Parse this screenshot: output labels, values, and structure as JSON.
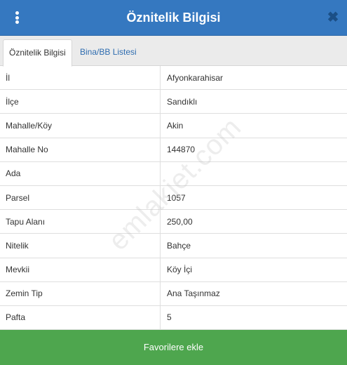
{
  "header": {
    "title": "Öznitelik Bilgisi",
    "close_glyph": "✖",
    "menu_icon": "vertical-dots-icon",
    "close_icon": "close-icon",
    "color": "#3578c0"
  },
  "tabs": [
    {
      "label": "Öznitelik Bilgisi",
      "active": true
    },
    {
      "label": "Bina/BB Listesi",
      "active": false
    }
  ],
  "rows": [
    {
      "label": "İl",
      "value": "Afyonkarahisar"
    },
    {
      "label": "İlçe",
      "value": "Sandıklı"
    },
    {
      "label": "Mahalle/Köy",
      "value": "Akin"
    },
    {
      "label": "Mahalle No",
      "value": "144870"
    },
    {
      "label": "Ada",
      "value": ""
    },
    {
      "label": "Parsel",
      "value": "1057"
    },
    {
      "label": "Tapu Alanı",
      "value": "250,00"
    },
    {
      "label": "Nitelik",
      "value": "Bahçe"
    },
    {
      "label": "Mevkii",
      "value": "Köy İçi"
    },
    {
      "label": "Zemin Tip",
      "value": "Ana Taşınmaz"
    },
    {
      "label": "Pafta",
      "value": "5"
    }
  ],
  "watermark": "emlakjet.com",
  "favorite_button": {
    "label": "Favorilere ekle",
    "color": "#4ea64e"
  }
}
